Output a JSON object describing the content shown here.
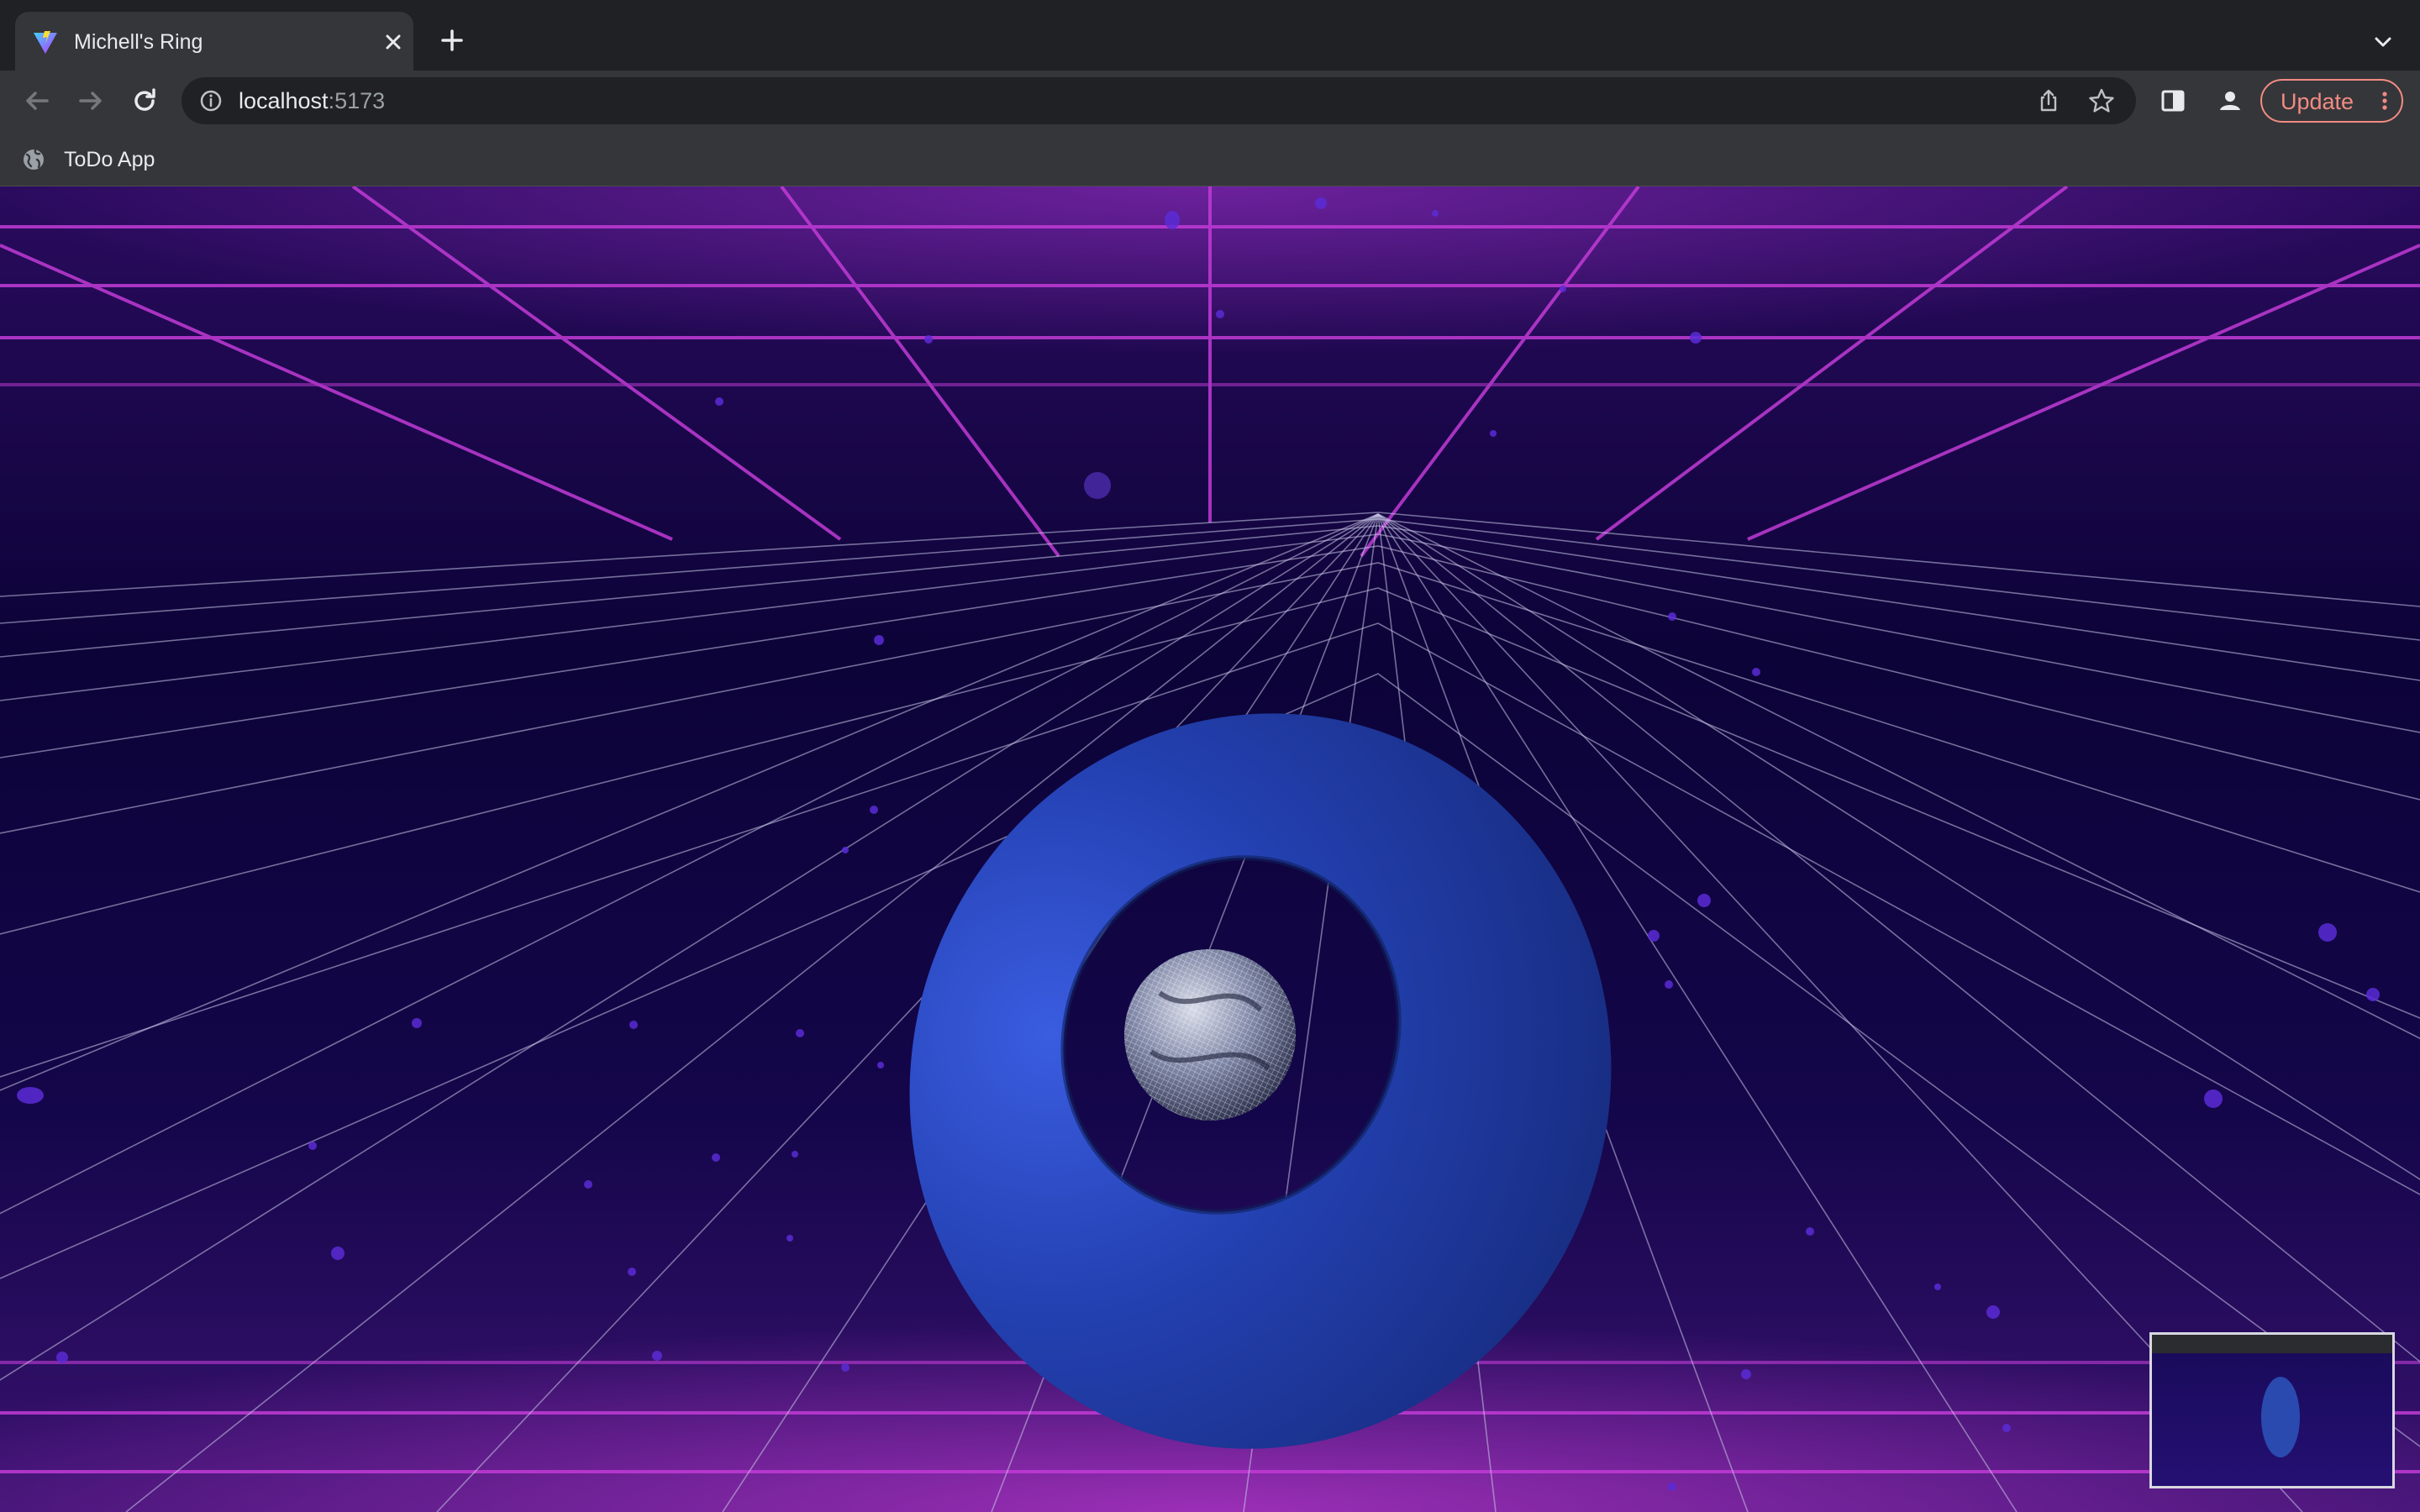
{
  "browser": {
    "tab": {
      "title": "Michell's Ring",
      "favicon": "vite-logo-icon"
    },
    "address": {
      "host": "localhost",
      "port": ":5173"
    },
    "update_label": "Update",
    "bookmarks": [
      {
        "label": "ToDo App",
        "icon": "globe-icon"
      }
    ],
    "icons": [
      "back-icon",
      "forward-icon",
      "reload-icon",
      "info-icon",
      "share-icon",
      "star-icon",
      "side-panel-icon",
      "profile-icon",
      "more-vert-icon",
      "tab-search-icon",
      "new-tab-icon",
      "close-icon"
    ]
  },
  "scene": {
    "description_colors": {
      "background": "#0d0536",
      "grid_lines": "#c8c8e8",
      "neon_grid": "#c13bd6",
      "ring": "#1f3a9c",
      "sphere": "#9aa0b8"
    },
    "objects": [
      "neon-grid-room",
      "floor-grid",
      "floating-particles",
      "blue-torus-ring",
      "wireframe-sphere"
    ],
    "minimap_thumbnail": true
  }
}
